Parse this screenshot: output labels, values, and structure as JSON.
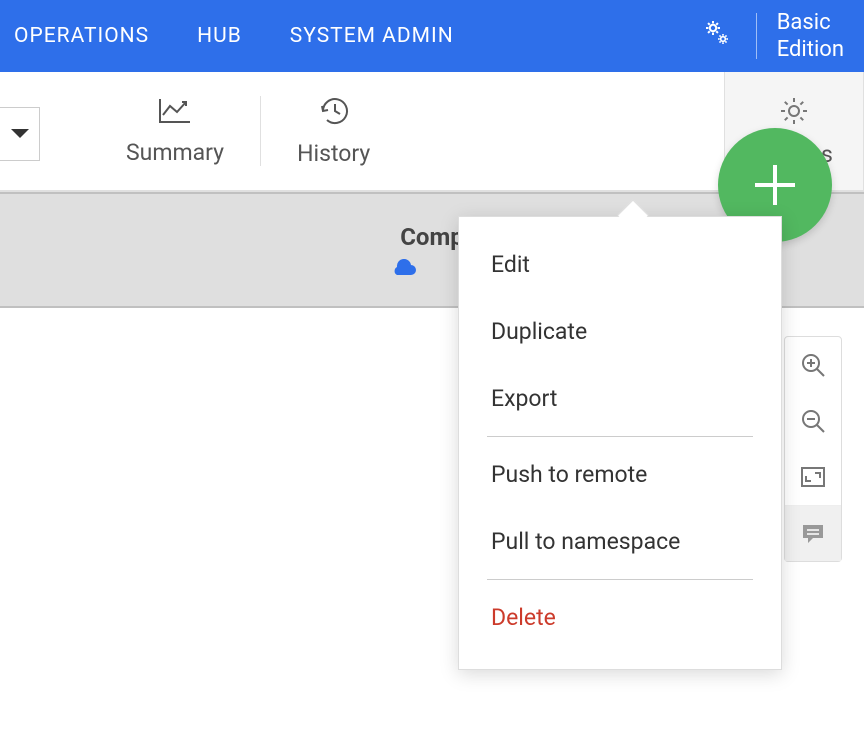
{
  "header": {
    "nav": [
      "OPERATIONS",
      "HUB",
      "SYSTEM ADMIN"
    ],
    "edition": "Basic\nEdition"
  },
  "toolbar": {
    "summary": "Summary",
    "history": "History",
    "actions": "Actions"
  },
  "grayBar": {
    "title": "Comp"
  },
  "actionsMenu": {
    "items": [
      {
        "label": "Edit"
      },
      {
        "label": "Duplicate"
      },
      {
        "label": "Export"
      },
      {
        "divider": true
      },
      {
        "label": "Push to remote"
      },
      {
        "label": "Pull to namespace"
      },
      {
        "divider": true
      },
      {
        "label": "Delete",
        "danger": true
      }
    ]
  }
}
